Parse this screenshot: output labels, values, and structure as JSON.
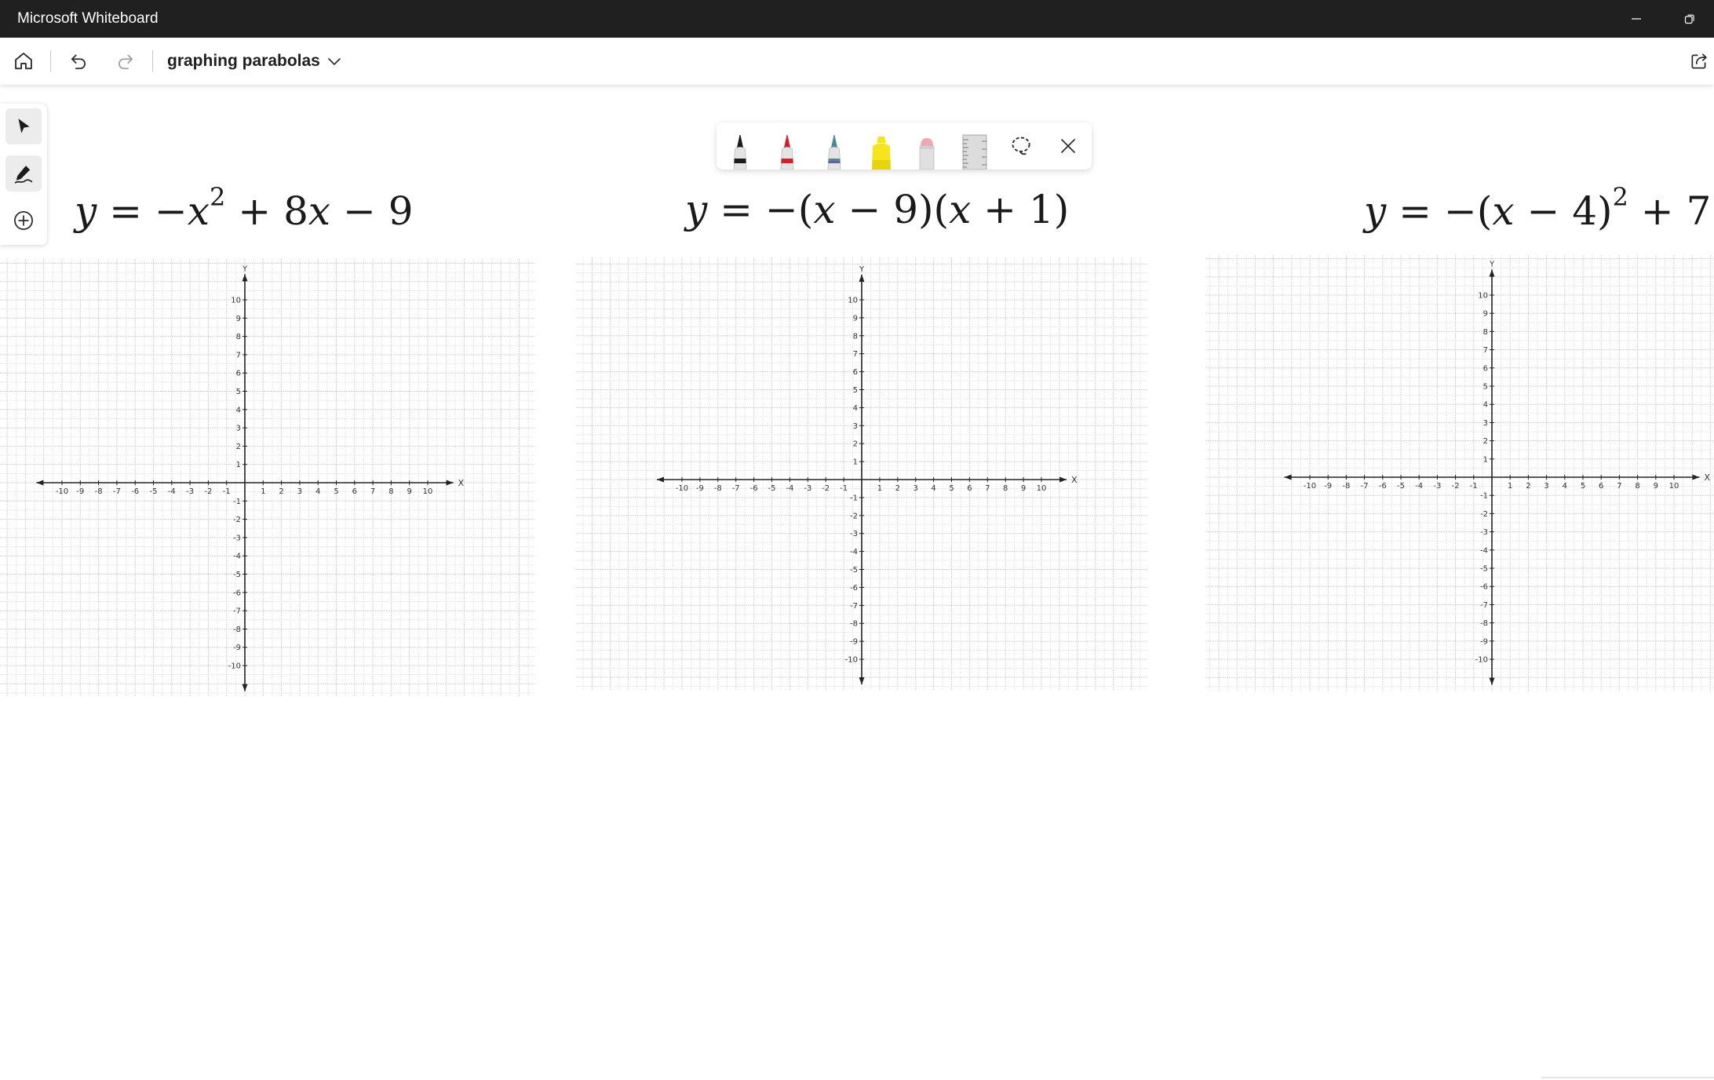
{
  "window": {
    "title": "Microsoft Whiteboard"
  },
  "commandbar": {
    "board_name": "graphing parabolas"
  },
  "equations": {
    "eq1": {
      "parts": [
        "y",
        " = −",
        "x",
        "2",
        " + 8",
        "x",
        " − 9"
      ]
    },
    "eq2": {
      "parts": [
        "y",
        " = −(",
        "x",
        " − 9)(",
        "x",
        " + 1)"
      ]
    },
    "eq3": {
      "parts": [
        "y",
        " = −(",
        "x",
        " − 4)",
        "2",
        " + 7"
      ]
    }
  },
  "graph": {
    "axis_x_label": "X",
    "axis_y_label": "Y",
    "ticks": [
      -10,
      -9,
      -8,
      -7,
      -6,
      -5,
      -4,
      -3,
      -2,
      -1,
      1,
      2,
      3,
      4,
      5,
      6,
      7,
      8,
      9,
      10
    ],
    "range": [
      -10,
      10
    ]
  },
  "ink_colors": {
    "black_pen": "#1b1b1b",
    "red_pen": "#d0202e",
    "galaxy_pen": "#4a8a9a",
    "highlighter": "#f5e61c",
    "eraser": "#f2a7b3"
  }
}
